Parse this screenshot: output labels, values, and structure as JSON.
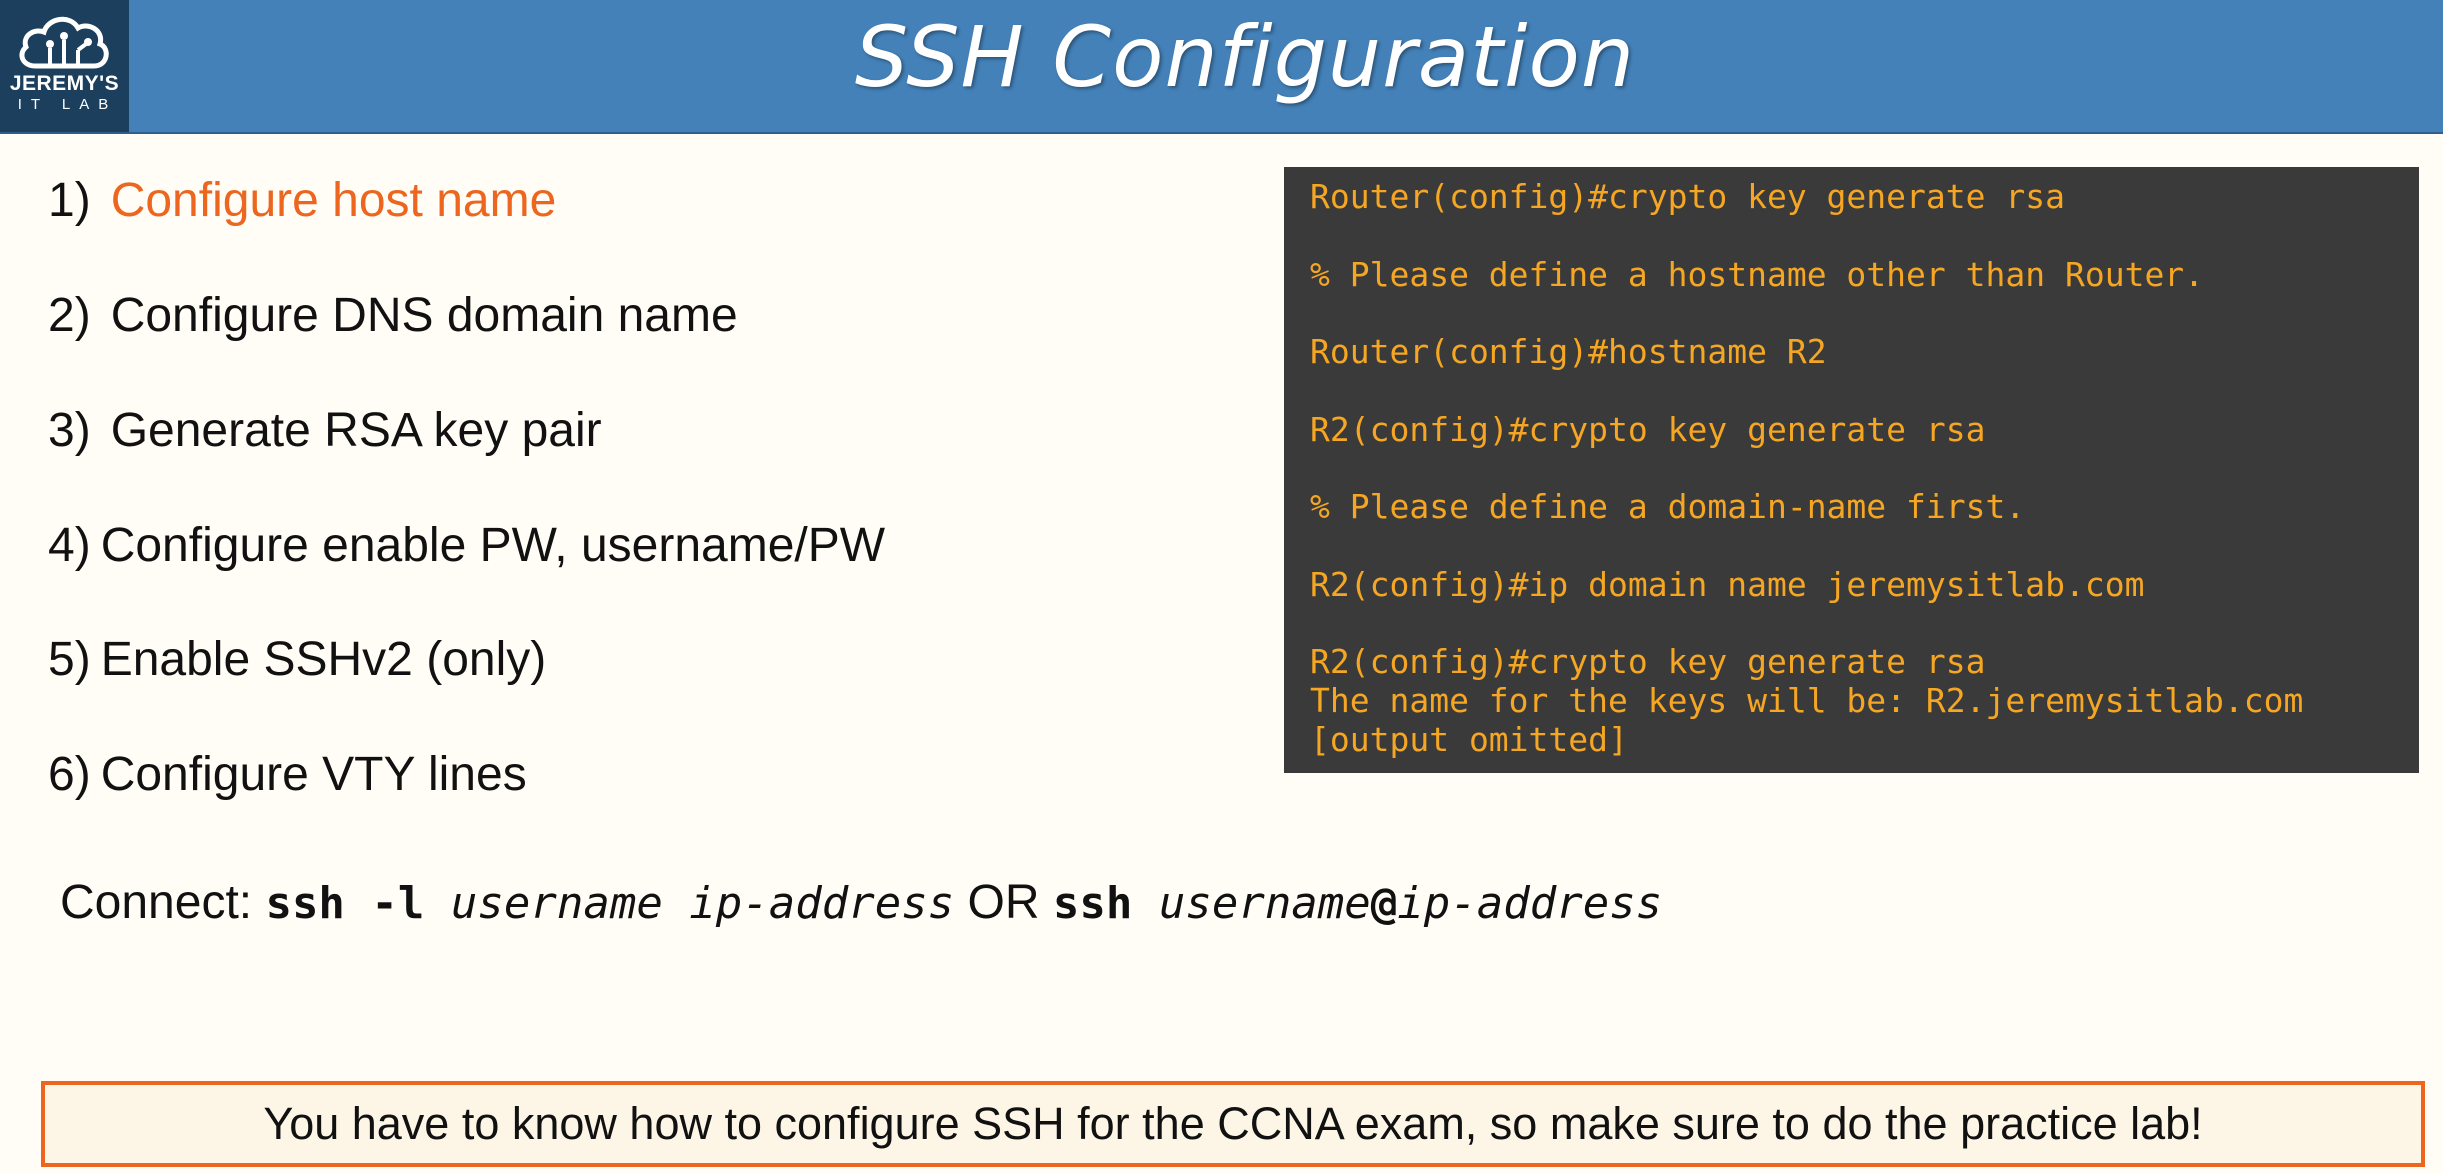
{
  "header": {
    "title": "SSH Configuration",
    "logo": {
      "line1": "JEREMY'S",
      "line2": "IT LAB",
      "icon": "cloud-circuit-icon"
    },
    "colors": {
      "header_bg": "#4381b8",
      "logo_bg": "#1d3f5e"
    }
  },
  "steps": [
    {
      "num": "1)",
      "text": "Configure host name"
    },
    {
      "num": "2)",
      "text": "Configure DNS domain name"
    },
    {
      "num": "3)",
      "text": "Generate RSA key pair"
    },
    {
      "num": "4)",
      "text": "Configure enable PW, username/PW"
    },
    {
      "num": "5)",
      "text": "Enable SSHv2 (only)"
    },
    {
      "num": "6)",
      "text": "Configure VTY lines"
    }
  ],
  "terminal": {
    "lines": [
      "Router(config)#crypto key generate rsa",
      "% Please define a hostname other than Router.",
      "Router(config)#hostname R2",
      "R2(config)#crypto key generate rsa",
      "% Please define a domain-name first.",
      "R2(config)#ip domain name jeremysitlab.com",
      "R2(config)#crypto key generate rsa",
      "The name for the keys will be: R2.jeremysitlab.com",
      "[output omitted]"
    ],
    "colors": {
      "bg": "#3a3a3a",
      "text": "#f5a623"
    }
  },
  "connect": {
    "label": "Connect: ",
    "cmd1": "ssh -l ",
    "arg1": "username ip-address",
    "or": " OR ",
    "cmd2": "ssh ",
    "arg2_user": "username",
    "at": "@",
    "arg2_ip": "ip-address"
  },
  "callout": {
    "text": "You have to know how to configure SSH for the CCNA exam, so make sure to do the practice lab!",
    "border_color": "#ec661f"
  }
}
